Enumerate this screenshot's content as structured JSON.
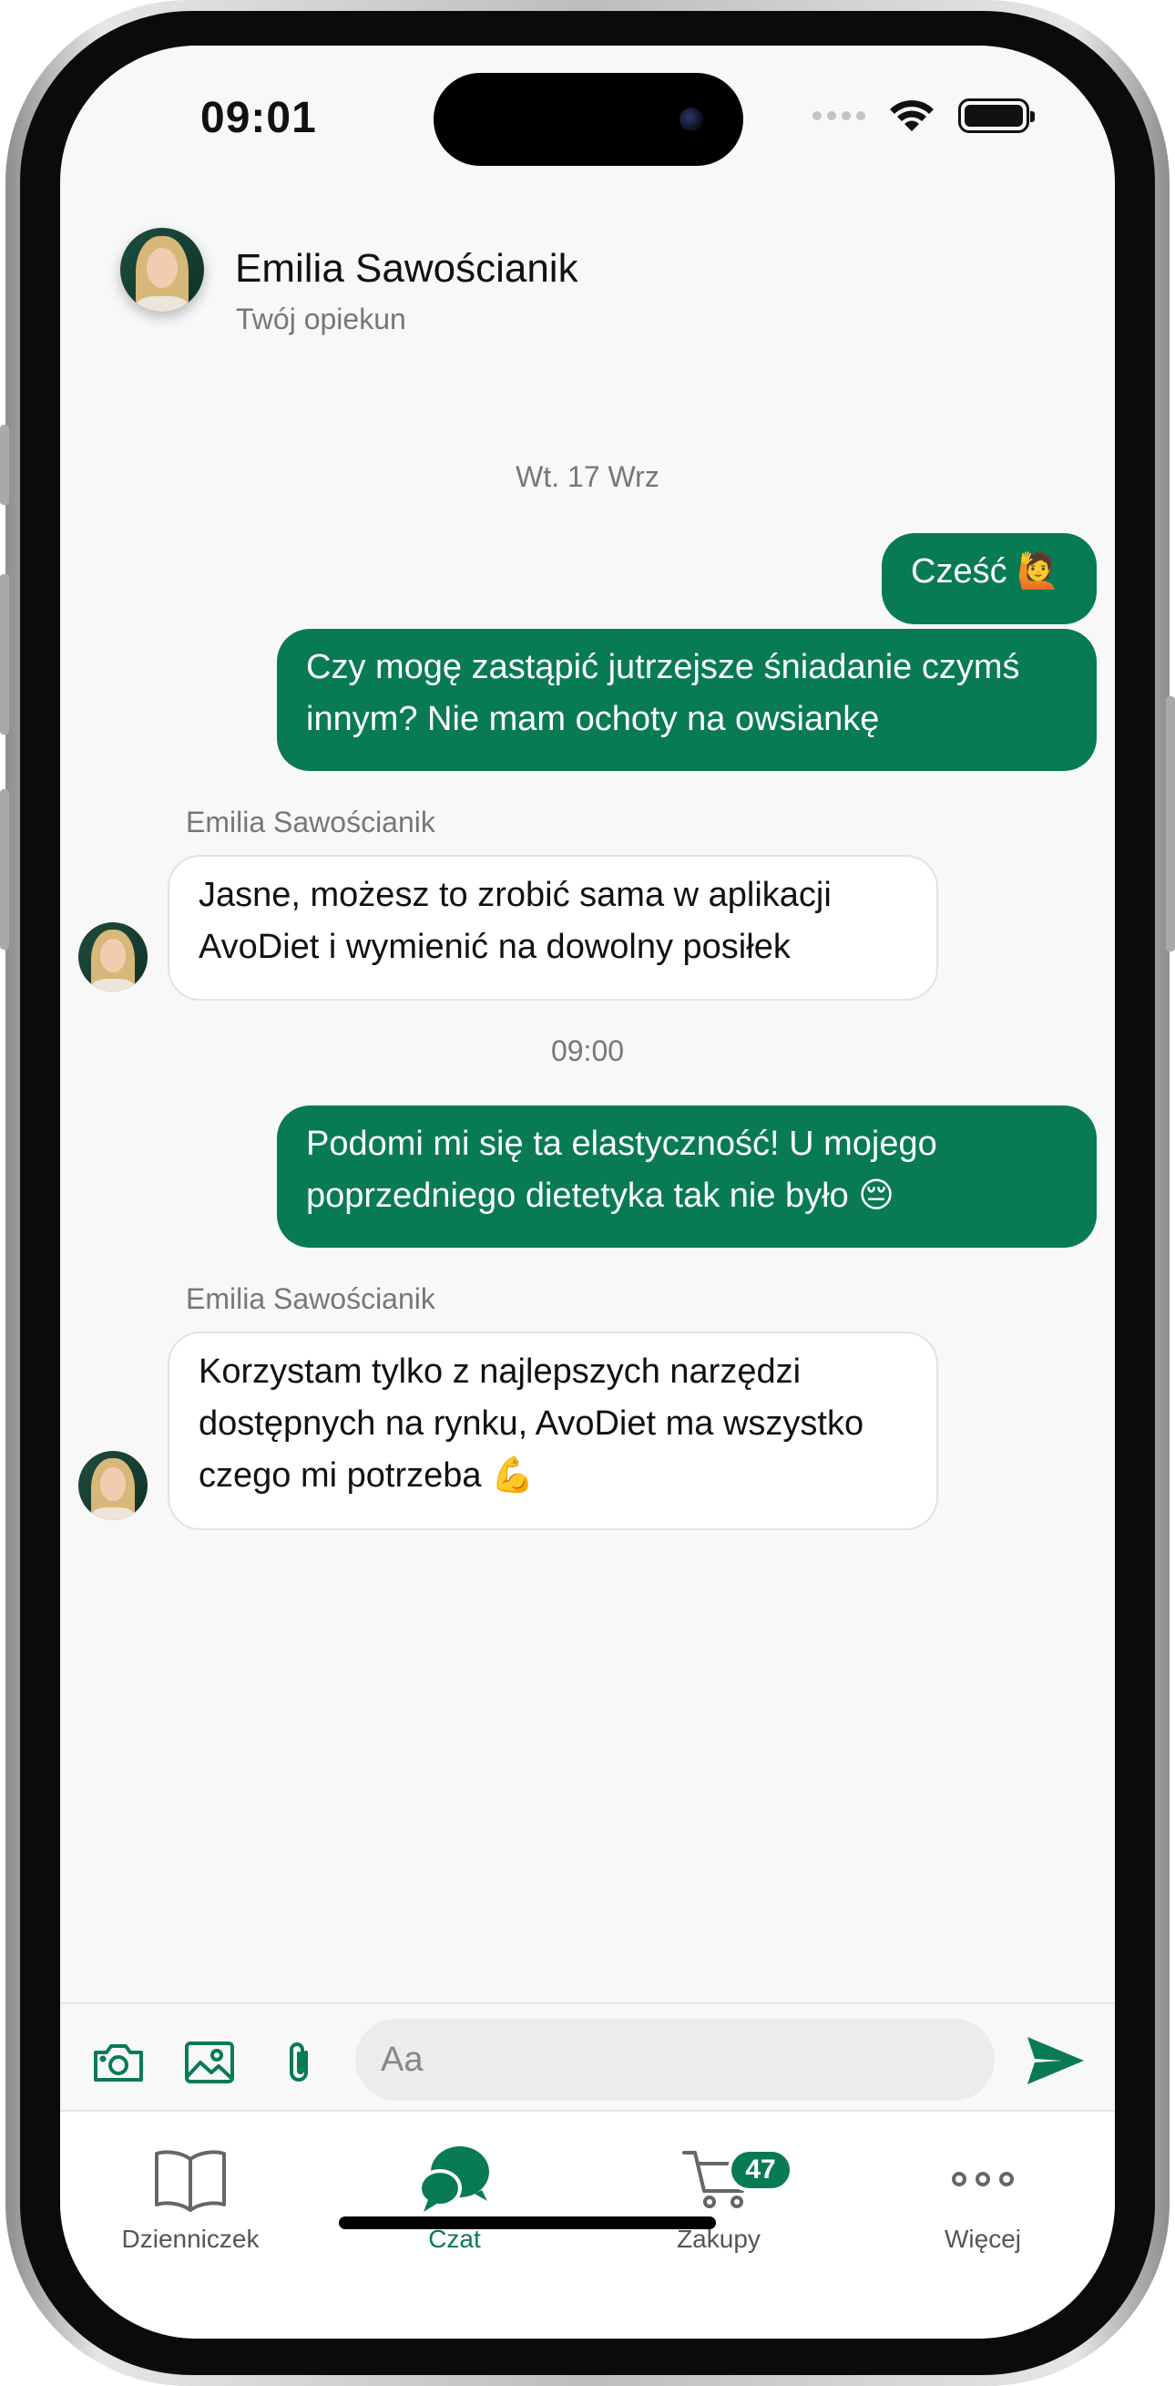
{
  "status_bar": {
    "time": "09:01"
  },
  "header": {
    "name": "Emilia Sawościanik",
    "subtitle": "Twój opiekun"
  },
  "chat": {
    "date": "Wt. 17 Wrz",
    "time_separator": "09:00",
    "messages": [
      {
        "direction": "outgoing",
        "text": "Cześć 🙋"
      },
      {
        "direction": "outgoing",
        "text": "Czy mogę zastąpić jutrzejsze śniadanie czymś innym? Nie mam ochoty na owsiankę"
      },
      {
        "direction": "incoming",
        "sender": "Emilia Sawościanik",
        "text": "Jasne, możesz to zrobić sama w aplikacji AvoDiet i wymienić na dowolny posiłek"
      },
      {
        "direction": "outgoing",
        "text": "Podomi mi się ta elastyczność! U mojego poprzedniego dietetyka tak nie było 😔"
      },
      {
        "direction": "incoming",
        "sender": "Emilia Sawościanik",
        "text": "Korzystam tylko z najlepszych narzędzi dostępnych na rynku, AvoDiet ma wszystko czego mi potrzeba 💪"
      }
    ]
  },
  "composer": {
    "placeholder": "Aa",
    "icons": [
      "camera-icon",
      "image-icon",
      "paperclip-icon",
      "send-icon"
    ]
  },
  "tabbar": {
    "tabs": [
      {
        "label": "Dzienniczek",
        "icon": "book-icon",
        "active": false
      },
      {
        "label": "Czat",
        "icon": "chat-bubbles-icon",
        "active": true
      },
      {
        "label": "Zakupy",
        "icon": "cart-icon",
        "active": false,
        "badge": "47"
      },
      {
        "label": "Więcej",
        "icon": "more-dots-icon",
        "active": false
      }
    ]
  },
  "colors": {
    "accent": "#087b54",
    "background": "#f8f8f8",
    "incoming_bubble": "#ffffff",
    "secondary_text": "#777777"
  }
}
